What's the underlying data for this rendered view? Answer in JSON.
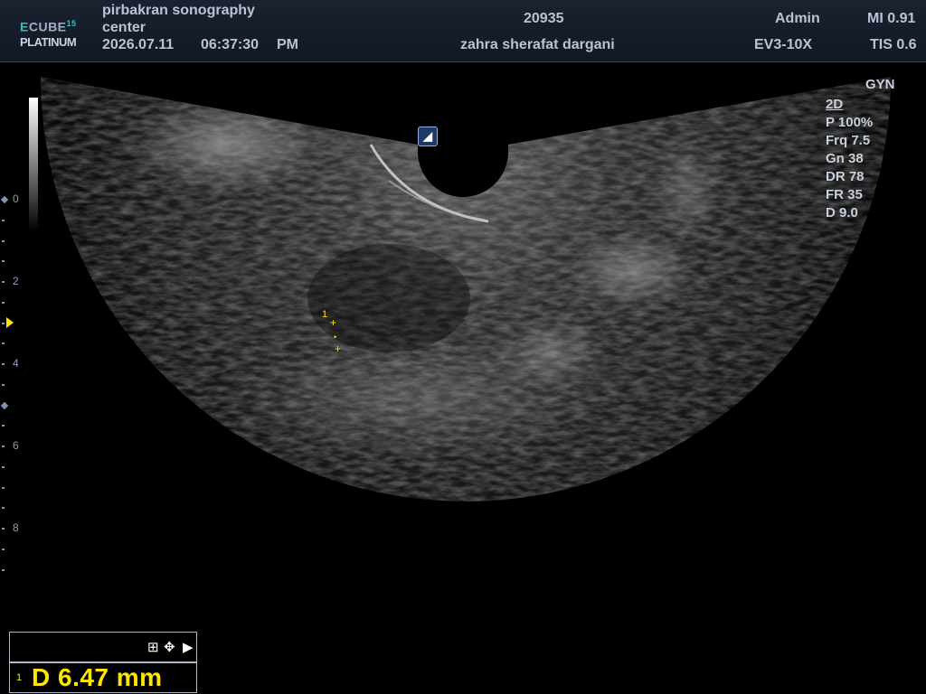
{
  "header": {
    "logo_line1_accent": "E",
    "logo_line1_rest": "CUBE",
    "logo_line1_sup": "15",
    "logo_line2": "PLATINUM",
    "institution_line1": "pirbakran sonography",
    "institution_line2": "center",
    "date": "2026.07.11",
    "time": "06:37:30",
    "ampm": "PM",
    "patient_id": "20935",
    "patient_name": "zahra sherafat dargani",
    "operator": "Admin",
    "probe": "EV3-10X",
    "mi": "MI 0.91",
    "tis": "TIS 0.6"
  },
  "params": {
    "preset": "GYN",
    "mode": "2D",
    "power": "P 100%",
    "frequency": "Frq 7.5",
    "gain": "Gn 38",
    "dynamic_range": "DR 78",
    "frame_rate": "FR 35",
    "depth": "D 9.0"
  },
  "depth_scale": {
    "labels": [
      "0",
      "2",
      "4",
      "6",
      "8"
    ]
  },
  "measurement": {
    "index": "1",
    "text": "D  6.47 mm",
    "caliper_label": "1"
  },
  "toolbar": {
    "grid_icon": "⊞",
    "move_icon": "✥",
    "next_icon": "▶"
  },
  "probe_marker": "◢",
  "colors": {
    "caliper": "#ffe600",
    "scale": "#7d92b6"
  }
}
